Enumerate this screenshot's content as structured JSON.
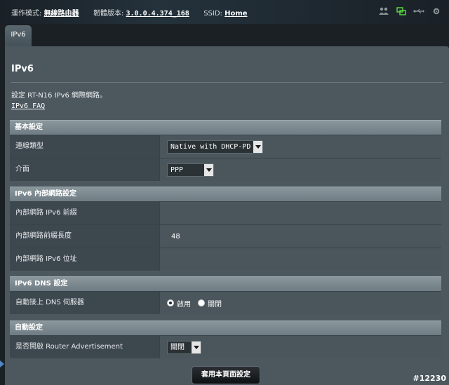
{
  "header": {
    "mode_label": "運作模式:",
    "mode_value": "無線路由器",
    "firmware_label": "韌體版本:",
    "firmware_value": "3.0.0.4.374_168",
    "ssid_label": "SSID:",
    "ssid_value": "Home",
    "icons": [
      "people-icon",
      "network-icon",
      "usb-icon",
      "settings-icon"
    ]
  },
  "tab": {
    "label": "IPv6"
  },
  "page": {
    "title": "IPv6",
    "description": "設定 RT-N16 IPv6 網際網路。",
    "faq_link": "IPv6 FAQ"
  },
  "basic": {
    "header": "基本設定",
    "connection_type_label": "連線類型",
    "connection_type_value": "Native with DHCP-PD",
    "interface_label": "介面",
    "interface_value": "PPP"
  },
  "lan": {
    "header": "IPv6 內部網路設定",
    "prefix_label": "內部網路 IPv6 前綴",
    "prefix_value": "",
    "prefix_length_label": "內部網路前綴長度",
    "prefix_length_value": "48",
    "address_label": "內部網路 IPv6 位址",
    "address_value": ""
  },
  "dns": {
    "header": "IPv6 DNS 設定",
    "auto_label": "自動接上 DNS 伺服器",
    "enable_label": "啟用",
    "disable_label": "關閉"
  },
  "auto": {
    "header": "自動設定",
    "ra_label": "是否開啟 Router Advertisement",
    "ra_value": "關閉"
  },
  "apply_label": "套用本頁面設定",
  "watermark": "#12230"
}
